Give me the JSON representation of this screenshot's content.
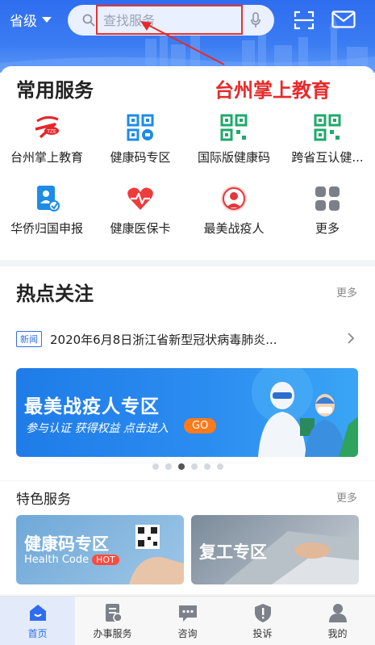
{
  "header": {
    "region_label": "省级",
    "search_placeholder": "查找服务",
    "annotation_label": "台州掌上教育"
  },
  "common_services": {
    "title": "常用服务",
    "items": [
      {
        "label": "台州掌上教育",
        "icon": "tze-logo-icon"
      },
      {
        "label": "健康码专区",
        "icon": "health-code-qr-icon"
      },
      {
        "label": "国际版健康码",
        "icon": "qr-code-icon"
      },
      {
        "label": "跨省互认健...",
        "icon": "qr-code-icon"
      },
      {
        "label": "华侨归国申报",
        "icon": "declaration-form-icon"
      },
      {
        "label": "健康医保卡",
        "icon": "heart-pulse-icon"
      },
      {
        "label": "最美战疫人",
        "icon": "medic-avatar-icon"
      },
      {
        "label": "更多",
        "icon": "grid-more-icon"
      }
    ]
  },
  "hot_topics": {
    "title": "热点关注",
    "more_label": "更多",
    "news_tag": "新闻",
    "news_text": "2020年6月8日浙江省新型冠状病毒肺炎...",
    "banner": {
      "title": "最美战疫人专区",
      "subtitle": "参与认证  获得权益  点击进入",
      "go_label": "GO"
    },
    "carousel_dots": 6,
    "carousel_active_index": 2
  },
  "featured": {
    "title": "特色服务",
    "more_label": "更多",
    "tiles": [
      {
        "title": "健康码专区",
        "subtitle": "Health Code",
        "badge": "HOT"
      },
      {
        "title": "复工专区"
      }
    ]
  },
  "bottom_nav": [
    {
      "label": "首页",
      "icon": "home-icon"
    },
    {
      "label": "办事服务",
      "icon": "document-icon"
    },
    {
      "label": "咨询",
      "icon": "chat-icon"
    },
    {
      "label": "投诉",
      "icon": "shield-alert-icon"
    },
    {
      "label": "我的",
      "icon": "user-icon"
    }
  ],
  "colors": {
    "brand_blue": "#2f6df0",
    "annotation_red": "#e62a2a"
  }
}
